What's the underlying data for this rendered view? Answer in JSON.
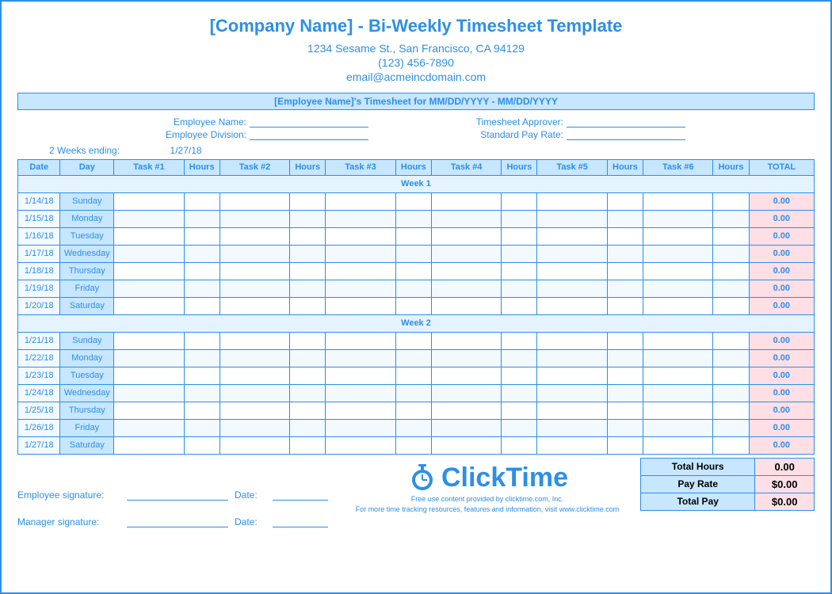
{
  "title": "[Company Name] - Bi-Weekly Timesheet Template",
  "address_line": "1234 Sesame St.,  San Francisco, CA 94129",
  "phone": "(123) 456-7890",
  "email": "email@acmeincdomain.com",
  "band": "[Employee Name]'s Timesheet for MM/DD/YYYY - MM/DD/YYYY",
  "meta": {
    "emp_name": "Employee Name:",
    "emp_div": "Employee Division:",
    "approver": "Timesheet Approver:",
    "payrate": "Standard Pay Rate:"
  },
  "ending": {
    "label": "2 Weeks ending:",
    "value": "1/27/18"
  },
  "headers": [
    "Date",
    "Day",
    "Task #1",
    "Hours",
    "Task #2",
    "Hours",
    "Task #3",
    "Hours",
    "Task #4",
    "Hours",
    "Task #5",
    "Hours",
    "Task #6",
    "Hours",
    "TOTAL"
  ],
  "week1_label": "Week 1",
  "week2_label": "Week 2",
  "week1": [
    {
      "date": "1/14/18",
      "day": "Sunday",
      "total": "0.00"
    },
    {
      "date": "1/15/18",
      "day": "Monday",
      "total": "0.00"
    },
    {
      "date": "1/16/18",
      "day": "Tuesday",
      "total": "0.00"
    },
    {
      "date": "1/17/18",
      "day": "Wednesday",
      "total": "0.00"
    },
    {
      "date": "1/18/18",
      "day": "Thursday",
      "total": "0.00"
    },
    {
      "date": "1/19/18",
      "day": "Friday",
      "total": "0.00"
    },
    {
      "date": "1/20/18",
      "day": "Saturday",
      "total": "0.00"
    }
  ],
  "week2": [
    {
      "date": "1/21/18",
      "day": "Sunday",
      "total": "0.00"
    },
    {
      "date": "1/22/18",
      "day": "Monday",
      "total": "0.00"
    },
    {
      "date": "1/23/18",
      "day": "Tuesday",
      "total": "0.00"
    },
    {
      "date": "1/24/18",
      "day": "Wednesday",
      "total": "0.00"
    },
    {
      "date": "1/25/18",
      "day": "Thursday",
      "total": "0.00"
    },
    {
      "date": "1/26/18",
      "day": "Friday",
      "total": "0.00"
    },
    {
      "date": "1/27/18",
      "day": "Saturday",
      "total": "0.00"
    }
  ],
  "summary": {
    "total_hours_label": "Total Hours",
    "total_hours": "0.00",
    "pay_rate_label": "Pay Rate",
    "pay_rate": "$0.00",
    "total_pay_label": "Total Pay",
    "total_pay": "$0.00"
  },
  "sign": {
    "emp": "Employee signature:",
    "mgr": "Manager signature:",
    "date": "Date:"
  },
  "brand": {
    "name": "ClickTime",
    "fine1": "Free use content provided by clicktime.com, Inc.",
    "fine2": "For more time tracking resources, features and information, visit www.clicktime.com"
  }
}
